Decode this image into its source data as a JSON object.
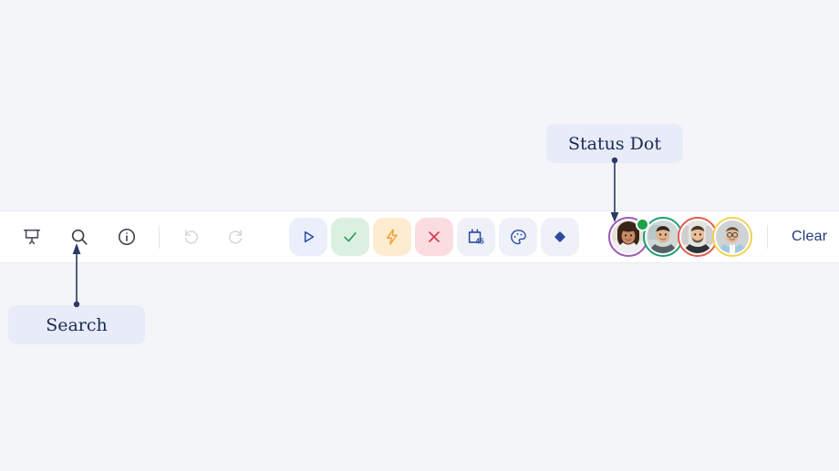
{
  "page": {
    "background_color": "#f4f5f8"
  },
  "toolbar": {
    "background_color": "#ffffff",
    "left_tools": [
      {
        "name": "presentation-icon",
        "label": "Present",
        "color": "#4a4f57"
      },
      {
        "name": "search-icon",
        "label": "Search",
        "color": "#3a3f48"
      },
      {
        "name": "info-icon",
        "label": "Info",
        "color": "#3a3f48"
      }
    ],
    "history_tools": [
      {
        "name": "undo-icon",
        "label": "Undo",
        "color": "#d4d7dd",
        "disabled": true
      },
      {
        "name": "redo-icon",
        "label": "Redo",
        "color": "#d4d7dd",
        "disabled": true
      }
    ],
    "action_buttons": [
      {
        "name": "play-button",
        "label": "Play",
        "icon": "play-icon",
        "bg": "#eaeffb",
        "fg": "#2b4ca0"
      },
      {
        "name": "approve-button",
        "label": "Approve",
        "icon": "check-icon",
        "bg": "#dcf0e2",
        "fg": "#2e9e5b"
      },
      {
        "name": "boost-button",
        "label": "Boost",
        "icon": "bolt-icon",
        "bg": "#fdeccf",
        "fg": "#f2a13a"
      },
      {
        "name": "reject-button",
        "label": "Reject",
        "icon": "close-icon",
        "bg": "#fbdde1",
        "fg": "#d8384c"
      },
      {
        "name": "calendar-button",
        "label": "Calendar",
        "icon": "calendar-45-icon",
        "bg": "#eef1f8",
        "fg": "#2b4ca0",
        "badge": "45"
      },
      {
        "name": "palette-button",
        "label": "Palette",
        "icon": "palette-icon",
        "bg": "#eef1f8",
        "fg": "#2b4ca0"
      },
      {
        "name": "diamond-button",
        "label": "Diamond",
        "icon": "diamond-icon",
        "bg": "#eef1f8",
        "fg": "#2b4ca0"
      }
    ],
    "avatars": [
      {
        "name": "avatar-1",
        "ring_color": "#9b59b6",
        "status": "online",
        "status_color": "#21a146",
        "skin": "#c98a64",
        "hair": "#3a2418",
        "shirt": "#f0eef0",
        "bg": "#e6e1d8"
      },
      {
        "name": "avatar-2",
        "ring_color": "#1f9d74",
        "status": "none",
        "skin": "#e0b48e",
        "hair": "#32241a",
        "shirt": "#595f66",
        "bg": "#cfd8d4"
      },
      {
        "name": "avatar-3",
        "ring_color": "#e35b4e",
        "status": "none",
        "skin": "#e8bd99",
        "hair": "#4a3526",
        "shirt": "#2f3338",
        "bg": "#e3e3e1"
      },
      {
        "name": "avatar-4",
        "ring_color": "#f3d24e",
        "status": "none",
        "skin": "#e3b894",
        "hair": "#5b4a3a",
        "shirt": "#9ec7e2",
        "bg": "#cfd3d6"
      }
    ],
    "clear_label": "Clear",
    "clear_color": "#1f3a7a"
  },
  "annotations": [
    {
      "name": "annotation-search",
      "label": "Search",
      "bg": "#e7ecf8",
      "text_color": "#1c2a52",
      "points_to": "search-icon",
      "direction": "up"
    },
    {
      "name": "annotation-status-dot",
      "label": "Status Dot",
      "bg": "#e7ecf8",
      "text_color": "#1c2a52",
      "points_to": "avatar-1-status-dot",
      "direction": "down"
    }
  ]
}
